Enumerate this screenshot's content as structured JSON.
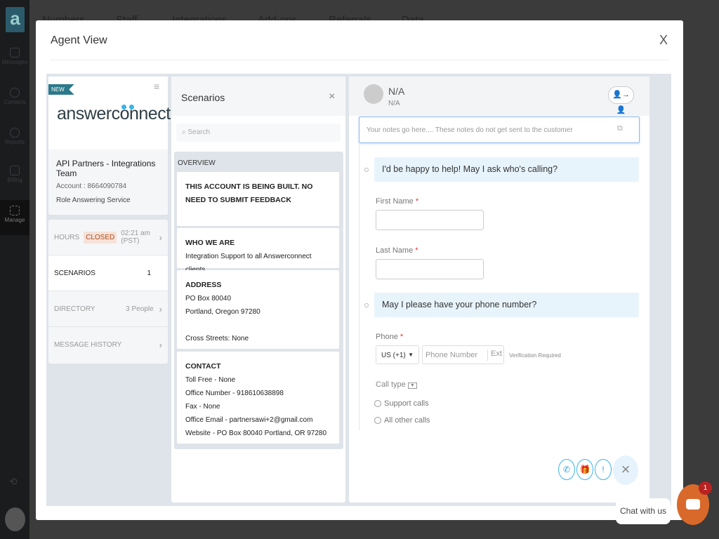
{
  "app": {
    "logo_letter": "a",
    "sidebar": [
      {
        "label": "Messages"
      },
      {
        "label": "Contacts"
      },
      {
        "label": "Reports"
      },
      {
        "label": "Billing"
      },
      {
        "label": "Manage",
        "active": true
      }
    ],
    "top_nav": [
      "Numbers",
      "Staff",
      "Integrations",
      "Add-ons",
      "Referrals",
      "Data"
    ]
  },
  "modal": {
    "title": "Agent View",
    "close": "X"
  },
  "account": {
    "new_tag": "NEW",
    "brand": "answerconnect",
    "name": "API Partners - Integrations Team",
    "account": "Account : 8664090784",
    "role": "Role Answering Service"
  },
  "nav": {
    "hours": {
      "label": "HOURS",
      "status": "CLOSED",
      "time": "02:21 am (PST)"
    },
    "scenarios": {
      "label": "SCENARIOS",
      "count": "1"
    },
    "directory": {
      "label": "DIRECTORY",
      "count": "3 People"
    },
    "history": {
      "label": "MESSAGE HISTORY"
    }
  },
  "scenarios": {
    "title": "Scenarios",
    "close": "×",
    "search_placeholder": "Search",
    "overview_label": "OVERVIEW",
    "notice": "THIS ACCOUNT IS BEING BUILT. NO NEED TO SUBMIT FEEDBACK",
    "who": {
      "title": "WHO WE ARE",
      "text": "Integration Support to all Answerconnect clients"
    },
    "address": {
      "title": "ADDRESS",
      "line1": "PO Box 80040",
      "line2": "Portland, Oregon 97280",
      "cross": "Cross Streets: None"
    },
    "contact": {
      "title": "CONTACT",
      "toll": "Toll Free - None",
      "office": "Office Number - 918610638898",
      "fax": "Fax - None",
      "email": "Office Email - partnersawi+2@gmail.com",
      "website": "Website - PO Box 80040 Portland, OR 97280"
    }
  },
  "caller": {
    "name": "N/A",
    "sub": "N/A",
    "notes_placeholder": "Your notes go here.... These notes do not get sent to the customer",
    "prompt1": "I'd be happy to help! May I ask who's calling?",
    "first_name": "First Name",
    "last_name": "Last Name",
    "prompt2": "May I please have your phone number?",
    "phone": "Phone",
    "country": "US (+1)",
    "phone_placeholder": "Phone Number",
    "ext": "Ext",
    "verification": "Verification Required",
    "call_type": "Call type",
    "options": [
      "Support calls",
      "All other calls"
    ],
    "required": "*"
  },
  "chat": {
    "label": "Chat with us",
    "badge": "1",
    "accent": "#d9692b"
  }
}
